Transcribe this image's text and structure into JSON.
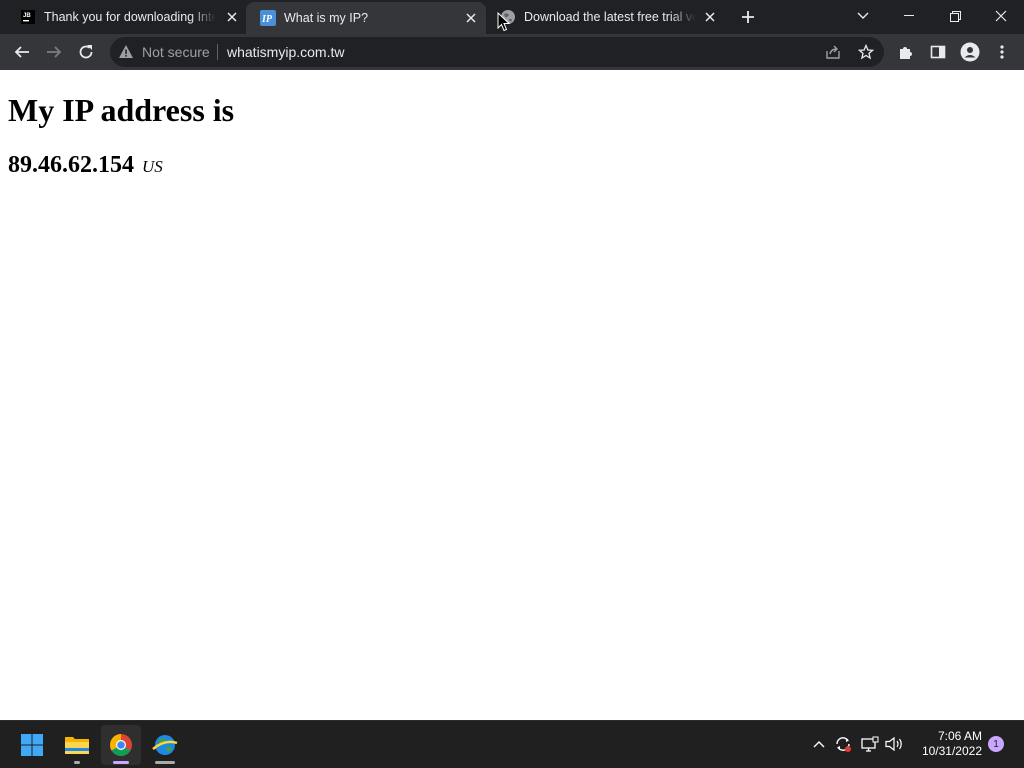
{
  "browser": {
    "tabs": [
      {
        "title": "Thank you for downloading IntelliJ IDEA",
        "favicon": "jetbrains-icon",
        "active": false
      },
      {
        "title": "What is my IP?",
        "favicon": "ip-icon",
        "active": true
      },
      {
        "title": "Download the latest free trial version",
        "favicon": "globe-icon",
        "active": false
      }
    ],
    "security_label": "Not secure",
    "url": "whatismyip.com.tw"
  },
  "page": {
    "heading": "My IP address is",
    "ip": "89.46.62.154",
    "country": "US"
  },
  "taskbar": {
    "apps": [
      "windows-start-icon",
      "file-explorer-icon",
      "chrome-icon",
      "network-globe-icon"
    ],
    "time": "7:06 AM",
    "date": "10/31/2022",
    "notification_count": "1"
  },
  "colors": {
    "titlebar": "#202124",
    "toolbar": "#35363a",
    "omnibox": "#202124",
    "taskbar": "#202020",
    "accent": "#c9a6ff"
  }
}
